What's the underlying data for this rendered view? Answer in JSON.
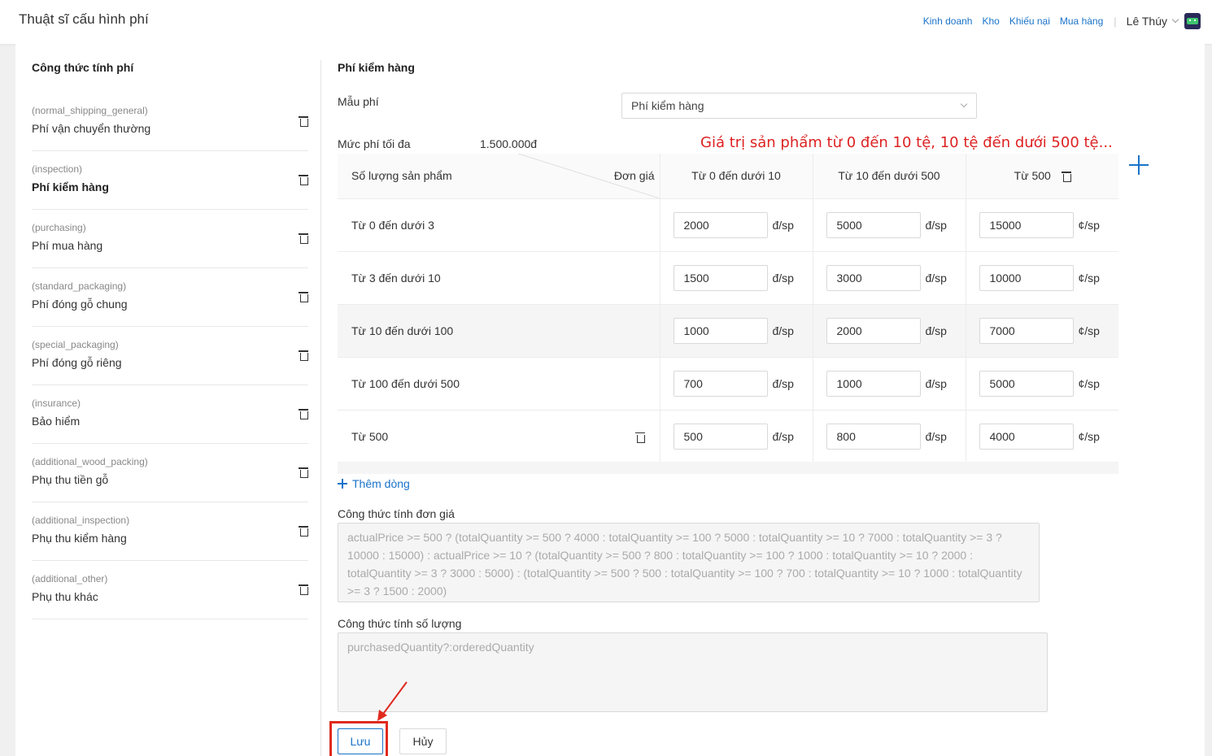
{
  "header": {
    "title": "Thuật sĩ cấu hình phí",
    "nav": [
      "Kinh doanh",
      "Kho",
      "Khiếu nại",
      "Mua hàng"
    ],
    "separator": "|",
    "user": "Lê Thúy"
  },
  "sidebar": {
    "title": "Công thức tính phí",
    "items": [
      {
        "code": "(normal_shipping_general)",
        "label": "Phí vận chuyển thường"
      },
      {
        "code": "(inspection)",
        "label": "Phí kiểm hàng"
      },
      {
        "code": "(purchasing)",
        "label": "Phí mua hàng"
      },
      {
        "code": "(standard_packaging)",
        "label": "Phí đóng gỗ chung"
      },
      {
        "code": "(special_packaging)",
        "label": "Phí đóng gỗ riêng"
      },
      {
        "code": "(insurance)",
        "label": "Bảo hiểm"
      },
      {
        "code": "(additional_wood_packing)",
        "label": "Phụ thu tiền gỗ"
      },
      {
        "code": "(additional_inspection)",
        "label": "Phụ thu kiểm hàng"
      },
      {
        "code": "(additional_other)",
        "label": "Phụ thu khác"
      }
    ],
    "active_index": 1
  },
  "main": {
    "title": "Phí kiểm hàng",
    "template_label": "Mẫu phí",
    "template_value": "Phí kiểm hàng",
    "max_label": "Mức phí tối đa",
    "max_value": "1.500.000đ",
    "annotation": "Giá trị sản phẩm từ 0 đến 10 tệ, 10 tệ đến dưới 500 tệ...",
    "table": {
      "corner_left": "Số lượng sản phẩm",
      "corner_right": "Đơn giá",
      "columns": [
        "Từ 0 đến dưới 10",
        "Từ 10 đến dưới 500",
        "Từ 500"
      ],
      "rows": [
        {
          "label": "Từ 0 đến dưới 3",
          "values": [
            "2000",
            "5000",
            "15000"
          ]
        },
        {
          "label": "Từ 3 đến dưới 10",
          "values": [
            "1500",
            "3000",
            "10000"
          ]
        },
        {
          "label": "Từ 10 đến dưới 100",
          "values": [
            "1000",
            "2000",
            "7000"
          ]
        },
        {
          "label": "Từ 100 đến dưới 500",
          "values": [
            "700",
            "1000",
            "5000"
          ]
        },
        {
          "label": "Từ 500",
          "values": [
            "500",
            "800",
            "4000"
          ]
        }
      ],
      "units": [
        "đ/sp",
        "đ/sp",
        "¢/sp"
      ],
      "highlighted_row": 2
    },
    "add_row_label": "Thêm dòng",
    "unit_price_formula_label": "Công thức tính đơn giá",
    "unit_price_formula": "actualPrice >= 500 ? (totalQuantity >= 500 ? 4000 : totalQuantity >= 100 ? 5000 : totalQuantity >= 10 ? 7000 : totalQuantity >= 3 ? 10000 : 15000) : actualPrice >= 10 ? (totalQuantity >= 500 ? 800 : totalQuantity >= 100 ? 1000 : totalQuantity >= 10 ? 2000 : totalQuantity >= 3 ? 3000 : 5000) : (totalQuantity >= 500 ? 500 : totalQuantity >= 100 ? 700 : totalQuantity >= 10 ? 1000 : totalQuantity >= 3 ? 1500 : 2000)",
    "quantity_formula_label": "Công thức tính số lượng",
    "quantity_formula": "purchasedQuantity?:orderedQuantity",
    "save_label": "Lưu",
    "cancel_label": "Hủy"
  },
  "colors": {
    "link": "#1a73c9",
    "annotation": "#d22222",
    "highlight": "#e0291e"
  }
}
